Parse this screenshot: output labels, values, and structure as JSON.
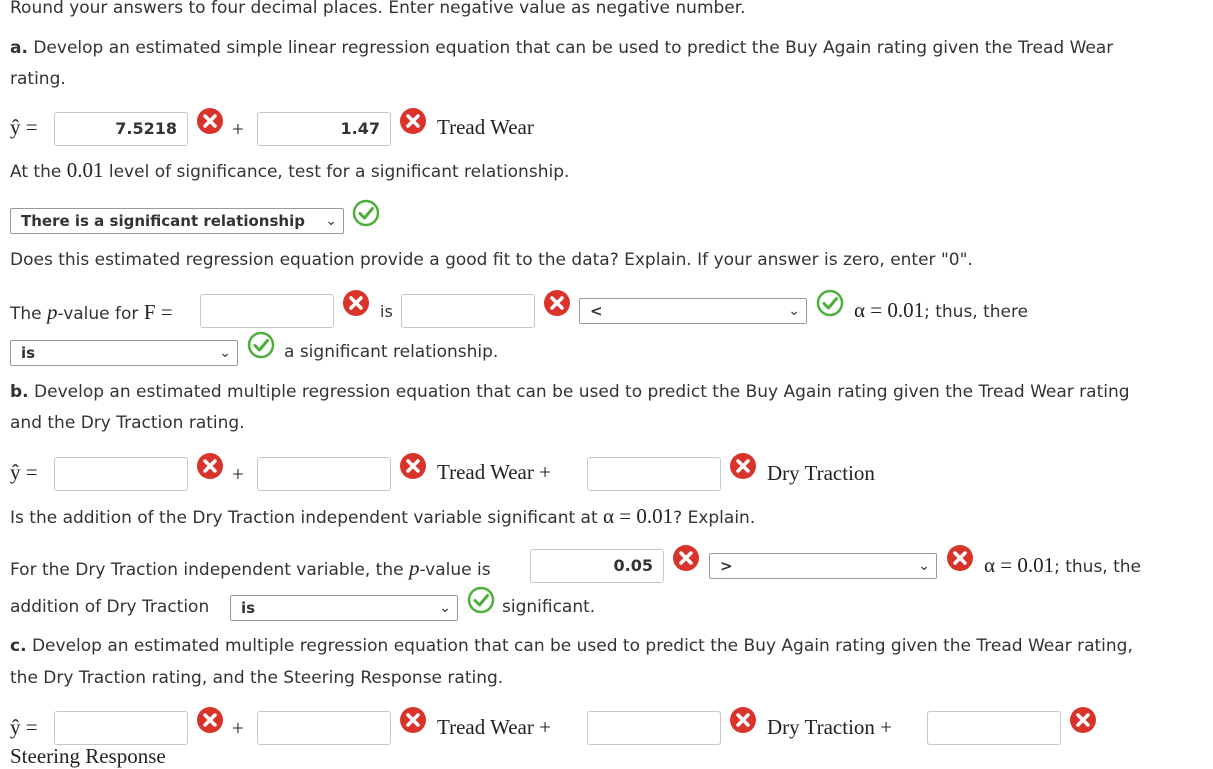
{
  "instructions": "Round your answers to four decimal places. Enter negative value as negative number.",
  "colors": {
    "wrong": "#d9342b",
    "correct": "#4caf3a"
  },
  "part_a": {
    "label": "a.",
    "question": "Develop an estimated simple linear regression equation that can be used to predict the Buy Again rating given the Tread Wear",
    "question_cont": "rating.",
    "yhat": "ŷ =",
    "intercept": "7.5218",
    "plus": "+",
    "slope": "1.47",
    "var1": "Tread Wear",
    "sig_text_pre": "At the",
    "sig_level": "0.01",
    "sig_text_post": "level of significance, test for a significant relationship.",
    "sig_select": "There is a significant relationship",
    "fit_question": "Does this estimated regression equation provide a good fit to the data? Explain. If your answer is zero, enter \"0\".",
    "pvalue_pre": "The",
    "pvalue_p": "p",
    "pvalue_mid": "-value for",
    "pvalue_F": "F =",
    "pvalue_value": "",
    "is": "is",
    "is_value": "",
    "compare_select": "<",
    "alpha_text": "α = 0.01",
    "thus_there": "; thus, there",
    "is_select": "is",
    "relationship_text": "a significant relationship."
  },
  "part_b": {
    "label": "b.",
    "question": "Develop an estimated multiple regression equation that can be used to predict the Buy Again rating given the Tread Wear rating",
    "question_cont": "and the Dry Traction rating.",
    "yhat": "ŷ =",
    "b0": "",
    "plus": "+",
    "b1": "",
    "var1": "Tread Wear +",
    "b2": "",
    "var2": "Dry Traction",
    "addition_q_pre": "Is the addition of the Dry Traction independent variable significant at",
    "addition_alpha": "α = 0.01",
    "addition_q_post": "? Explain.",
    "dry_p_pre": "For the Dry Traction independent variable, the",
    "dry_p_p": "p",
    "dry_p_post": "-value is",
    "dry_p_value": "0.05",
    "compare_select": ">",
    "alpha_text": "α = 0.01",
    "thus_the": "; thus, the",
    "addition_of": "addition of Dry Traction",
    "is_select": "is",
    "significant": "significant."
  },
  "part_c": {
    "label": "c.",
    "question": "Develop an estimated multiple regression equation that can be used to predict the Buy Again rating given the Tread Wear rating,",
    "question_cont": "the Dry Traction rating, and the Steering Response rating.",
    "yhat": "ŷ =",
    "plus": "+",
    "var1": "Tread Wear +",
    "var2": "Dry Traction +",
    "var3": "Steering Response"
  }
}
